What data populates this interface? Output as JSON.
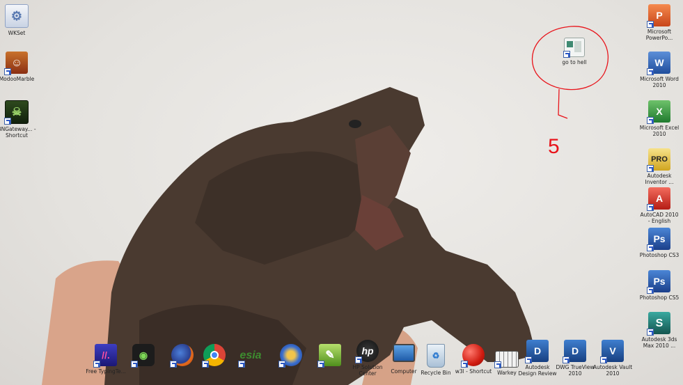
{
  "annotation": {
    "number": "5",
    "color": "#e8141b"
  },
  "desktop_icons": {
    "left": [
      {
        "label": "WKSet",
        "icon": "settings-icon"
      },
      {
        "label": "ModooMarble",
        "icon": "game-character-icon"
      },
      {
        "label": "BNGateway... - Shortcut",
        "icon": "game-monster-icon"
      }
    ],
    "highlighted": {
      "label": "go to hell",
      "icon": "program-window-icon"
    },
    "right": [
      {
        "label": "Microsoft PowerPo...",
        "icon": "powerpoint-icon"
      },
      {
        "label": "Microsoft Word 2010",
        "icon": "word-icon"
      },
      {
        "label": "Microsoft Excel 2010",
        "icon": "excel-icon"
      },
      {
        "label": "Autodesk Inventor ...",
        "icon": "inventor-icon"
      },
      {
        "label": "AutoCAD 2010 - English",
        "icon": "autocad-icon"
      },
      {
        "label": "Photoshop CS3",
        "icon": "photoshop-icon"
      },
      {
        "label": "Photoshop CS5",
        "icon": "photoshop-icon"
      },
      {
        "label": "Autodesk 3ds Max 2010 ...",
        "icon": "3dsmax-icon"
      }
    ],
    "bottom": [
      {
        "label": "Free TypingTe...",
        "icon": "typing-icon"
      },
      {
        "label": "",
        "icon": "webcam-icon"
      },
      {
        "label": "",
        "icon": "firefox-icon"
      },
      {
        "label": "",
        "icon": "chrome-icon"
      },
      {
        "label": "",
        "icon": "esia-icon"
      },
      {
        "label": "",
        "icon": "circle-app-icon"
      },
      {
        "label": "",
        "icon": "green-app-icon"
      },
      {
        "label": "HP Solution Center",
        "icon": "hp-icon"
      },
      {
        "label": "Computer",
        "icon": "computer-icon"
      },
      {
        "label": "Recycle Bin",
        "icon": "recycle-bin-icon"
      },
      {
        "label": "w3l - Shortcut",
        "icon": "red-ball-icon"
      },
      {
        "label": "Warkey",
        "icon": "keyboard-icon"
      },
      {
        "label": "Autodesk Design Review",
        "icon": "design-review-icon"
      },
      {
        "label": "DWG TrueView 2010",
        "icon": "dwg-trueview-icon"
      },
      {
        "label": "Autodesk Vault 2010",
        "icon": "vault-icon"
      }
    ]
  }
}
